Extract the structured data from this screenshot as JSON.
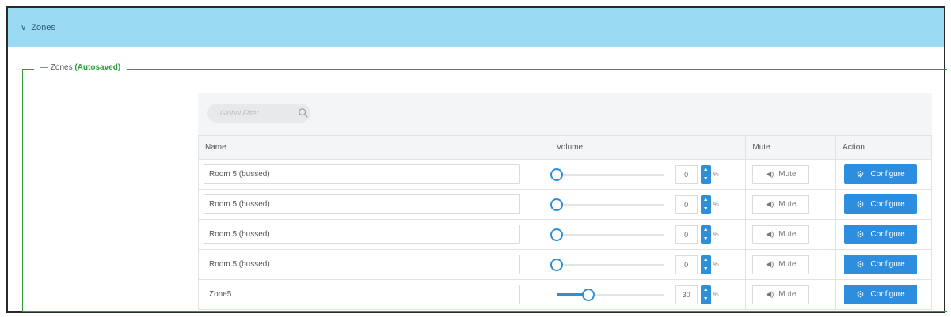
{
  "header": {
    "title": "Zones",
    "chevron_icon": "chevron-down-icon"
  },
  "fieldset": {
    "legend_prefix": "Zones",
    "legend_status": "(Autosaved)"
  },
  "search": {
    "placeholder": "Global Filter",
    "icon": "search-icon"
  },
  "table": {
    "columns": [
      "Name",
      "Volume",
      "Mute",
      "Action"
    ],
    "rows": [
      {
        "name": "Room 5 (bussed)",
        "volume": "0",
        "volume_level": 0,
        "unit": "%",
        "mute_label": "Mute",
        "action_label": "Configure"
      },
      {
        "name": "Room 5 (bussed)",
        "volume": "0",
        "volume_level": 0,
        "unit": "%",
        "mute_label": "Mute",
        "action_label": "Configure"
      },
      {
        "name": "Room 5 (bussed)",
        "volume": "0",
        "volume_level": 0,
        "unit": "%",
        "mute_label": "Mute",
        "action_label": "Configure"
      },
      {
        "name": "Room 5 (bussed)",
        "volume": "0",
        "volume_level": 0,
        "unit": "%",
        "mute_label": "Mute",
        "action_label": "Configure"
      },
      {
        "name": "Zone5",
        "volume": "30",
        "volume_level": 30,
        "unit": "%",
        "mute_label": "Mute",
        "action_label": "Configure"
      }
    ]
  },
  "colors": {
    "header_bg": "#9bdaf3",
    "accent_green": "#2c9c3a",
    "accent_blue": "#2d8ee0"
  }
}
